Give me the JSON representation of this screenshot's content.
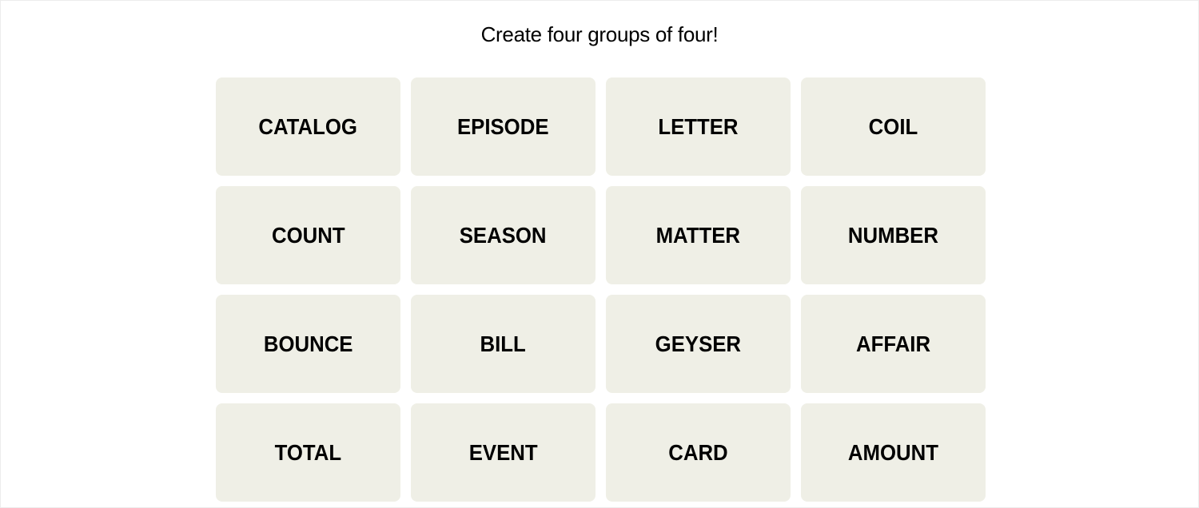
{
  "header": {
    "title": "Create four groups of four!"
  },
  "colors": {
    "tile_bg": "#efefe6",
    "text": "#000000"
  },
  "tiles": [
    "CATALOG",
    "EPISODE",
    "LETTER",
    "COIL",
    "COUNT",
    "SEASON",
    "MATTER",
    "NUMBER",
    "BOUNCE",
    "BILL",
    "GEYSER",
    "AFFAIR",
    "TOTAL",
    "EVENT",
    "CARD",
    "AMOUNT"
  ]
}
